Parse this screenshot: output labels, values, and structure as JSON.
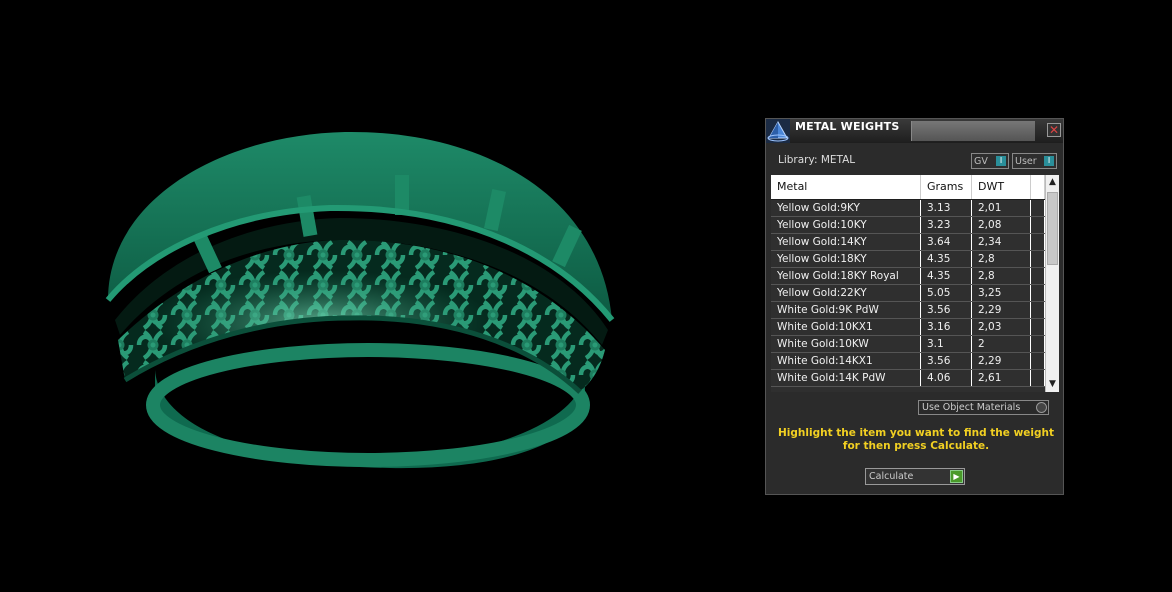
{
  "panel": {
    "title": "METAL WEIGHTS",
    "library_label": "Library: METAL",
    "toggle_gv": "GV",
    "toggle_user": "User",
    "close": "✕",
    "columns": [
      "Metal",
      "Grams",
      "DWT"
    ],
    "rows": [
      {
        "metal": "Yellow Gold:9KY",
        "grams": "3.13",
        "dwt": "2,01"
      },
      {
        "metal": "Yellow Gold:10KY",
        "grams": "3.23",
        "dwt": "2,08"
      },
      {
        "metal": "Yellow Gold:14KY",
        "grams": "3.64",
        "dwt": "2,34"
      },
      {
        "metal": "Yellow Gold:18KY",
        "grams": "4.35",
        "dwt": "2,8"
      },
      {
        "metal": "Yellow Gold:18KY Royal",
        "grams": "4.35",
        "dwt": "2,8"
      },
      {
        "metal": "Yellow Gold:22KY",
        "grams": "5.05",
        "dwt": "3,25"
      },
      {
        "metal": "White Gold:9K PdW",
        "grams": "3.56",
        "dwt": "2,29"
      },
      {
        "metal": "White Gold:10KX1",
        "grams": "3.16",
        "dwt": "2,03"
      },
      {
        "metal": "White Gold:10KW",
        "grams": "3.1",
        "dwt": "2"
      },
      {
        "metal": "White Gold:14KX1",
        "grams": "3.56",
        "dwt": "2,29"
      },
      {
        "metal": "White Gold:14K PdW",
        "grams": "4.06",
        "dwt": "2,61"
      }
    ],
    "use_object_materials": "Use Object Materials",
    "instruction": "Highlight the item you want to find the weight for then press Calculate.",
    "calculate_label": "Calculate"
  },
  "colors": {
    "background": "#000000",
    "ring_green": "#1f8a68",
    "instruction_text": "#f2d022",
    "toggle_indicator": "#2a8f9a"
  },
  "icons": {
    "logo": "pyramid-logo-icon",
    "close": "close-icon",
    "scroll_up": "scroll-up-icon",
    "scroll_down": "scroll-down-icon",
    "calculate": "play-arrow-icon"
  }
}
